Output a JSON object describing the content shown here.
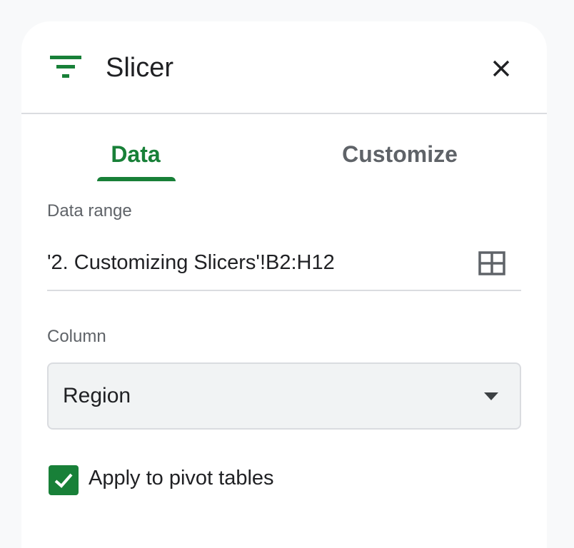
{
  "header": {
    "title": "Slicer",
    "filter_icon": "filter-icon",
    "close_icon": "close-icon"
  },
  "tabs": [
    {
      "label": "Data",
      "active": true
    },
    {
      "label": "Customize",
      "active": false
    }
  ],
  "data_range": {
    "label": "Data range",
    "value": "'2. Customizing Slicers'!B2:H12",
    "icon": "grid-select-icon"
  },
  "column": {
    "label": "Column",
    "selected": "Region",
    "icon": "dropdown-arrow-icon"
  },
  "pivot": {
    "label": "Apply to pivot tables",
    "checked": true
  },
  "colors": {
    "accent": "#188038",
    "text": "#202124",
    "muted": "#5f6368",
    "divider": "#dadce0"
  }
}
